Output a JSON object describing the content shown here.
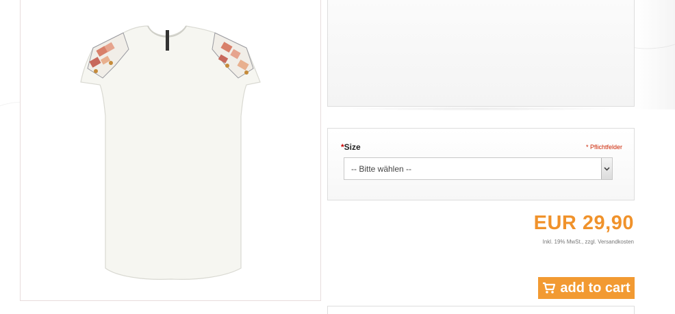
{
  "product": {
    "image_alt": "White embroidered T-shirt"
  },
  "options": {
    "size_label": "Size",
    "required_star": "*",
    "required_note": "* Pflichtfelder",
    "size_select_value": "-- Bitte wählen --"
  },
  "pricing": {
    "price": "EUR 29,90",
    "tax_note": "Inkl. 19% MwSt., zzgl. Versandkosten"
  },
  "cart": {
    "add_label": "add to cart",
    "icon": "cart-icon"
  },
  "colors": {
    "accent": "#f29a32",
    "price": "#f0922b",
    "required": "#cc2200"
  }
}
